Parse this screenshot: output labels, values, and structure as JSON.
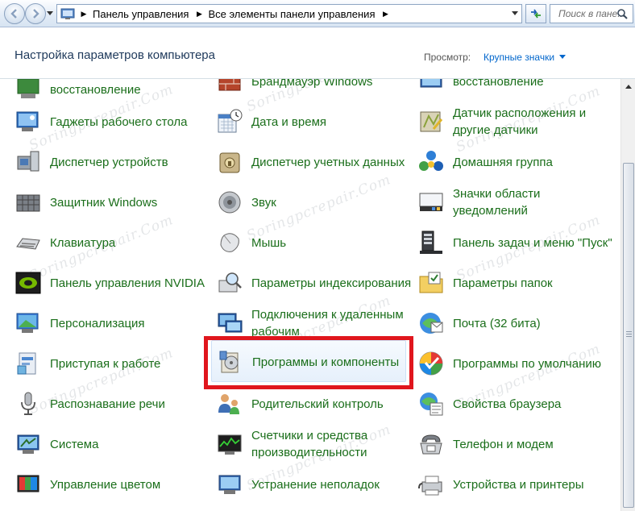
{
  "address_bar": {
    "crumbs": [
      "Панель управления",
      "Все элементы панели управления"
    ],
    "search_placeholder": "Поиск в пане..."
  },
  "header": {
    "title": "Настройка параметров компьютера",
    "view_label": "Просмотр:",
    "view_value": "Крупные значки"
  },
  "items": {
    "col1": [
      {
        "label": "восстановление",
        "icon": "backup-restore-icon"
      },
      {
        "label": "Гаджеты рабочего стола",
        "icon": "desktop-gadgets-icon"
      },
      {
        "label": "Диспетчер устройств",
        "icon": "device-manager-icon"
      },
      {
        "label": "Защитник Windows",
        "icon": "windows-defender-icon"
      },
      {
        "label": "Клавиатура",
        "icon": "keyboard-icon"
      },
      {
        "label": "Панель управления NVIDIA",
        "icon": "nvidia-icon"
      },
      {
        "label": "Персонализация",
        "icon": "personalization-icon"
      },
      {
        "label": "Приступая к работе",
        "icon": "getting-started-icon"
      },
      {
        "label": "Распознавание речи",
        "icon": "microphone-icon"
      },
      {
        "label": "Система",
        "icon": "system-icon"
      },
      {
        "label": "Управление цветом",
        "icon": "color-management-icon"
      }
    ],
    "col2": [
      {
        "label": "Брандмауэр Windows",
        "icon": "firewall-icon"
      },
      {
        "label": "Дата и время",
        "icon": "date-time-icon"
      },
      {
        "label": "Диспетчер учетных данных",
        "icon": "credential-manager-icon"
      },
      {
        "label": "Звук",
        "icon": "sound-icon"
      },
      {
        "label": "Мышь",
        "icon": "mouse-icon"
      },
      {
        "label": "Параметры индексирования",
        "icon": "indexing-icon"
      },
      {
        "label": "Подключения к удаленным рабочим",
        "icon": "remote-desktop-icon"
      },
      {
        "label": "Программы и компоненты",
        "icon": "programs-features-icon"
      },
      {
        "label": "Родительский контроль",
        "icon": "parental-controls-icon"
      },
      {
        "label": "Счетчики и средства производительности",
        "icon": "performance-icon"
      },
      {
        "label": "Устранение неполадок",
        "icon": "troubleshooting-icon"
      }
    ],
    "col3": [
      {
        "label": "восстановление",
        "icon": "recovery-icon"
      },
      {
        "label": "Датчик расположения и другие датчики",
        "icon": "location-sensors-icon"
      },
      {
        "label": "Домашняя группа",
        "icon": "homegroup-icon"
      },
      {
        "label": "Значки области уведомлений",
        "icon": "notification-icons-icon"
      },
      {
        "label": "Панель задач и меню \"Пуск\"",
        "icon": "taskbar-icon"
      },
      {
        "label": "Параметры папок",
        "icon": "folder-options-icon"
      },
      {
        "label": "Почта (32 бита)",
        "icon": "mail-icon"
      },
      {
        "label": "Программы по умолчанию",
        "icon": "default-programs-icon"
      },
      {
        "label": "Свойства браузера",
        "icon": "internet-options-icon"
      },
      {
        "label": "Телефон и модем",
        "icon": "phone-modem-icon"
      },
      {
        "label": "Устройства и принтеры",
        "icon": "devices-printers-icon"
      }
    ]
  },
  "watermark": "Soringpcrepair.Com",
  "colors": {
    "link_green": "#1a6e1a",
    "highlight_red": "#e0161d",
    "title_blue": "#1e395b"
  }
}
